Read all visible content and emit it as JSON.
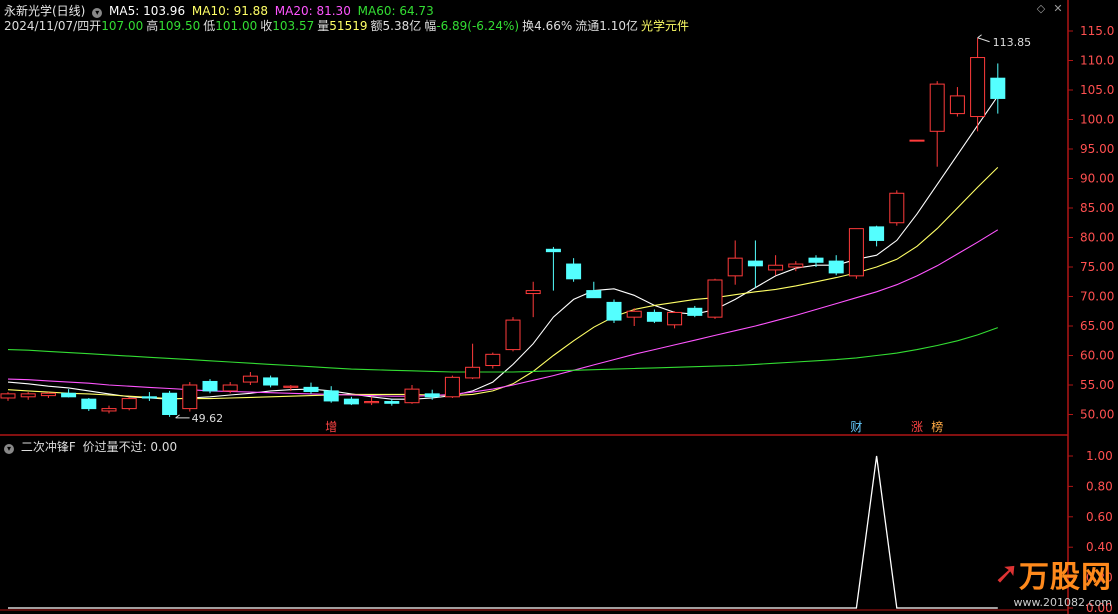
{
  "header": {
    "stock_name": "永新光学(日线)",
    "ma": [
      {
        "label": "MA5: 103.96",
        "color": "#ffffff"
      },
      {
        "label": "MA10: 91.88",
        "color": "#ffff66"
      },
      {
        "label": "MA20: 81.30",
        "color": "#ff55ff"
      },
      {
        "label": "MA60: 64.73",
        "color": "#33dd33"
      }
    ],
    "date": "2024/11/07/四",
    "open_label": "开",
    "open_value": "107.00",
    "high_label": "高",
    "high_value": "109.50",
    "low_label": "低",
    "low_value": "101.00",
    "close_label": "收",
    "close_value": "103.57",
    "vol_label": "量",
    "vol_value": "51519",
    "amt_label": "额",
    "amt_value": "5.38亿",
    "chg_label": "幅",
    "chg_value": "-6.89(-6.24%)",
    "turn_label": "换",
    "turn_value": "4.66%",
    "float_label": "流通",
    "float_value": "1.10亿",
    "sector": "光学元件"
  },
  "indicator_header": {
    "name": "二次冲锋F",
    "param": "价过量不过: 0.00"
  },
  "colors": {
    "up": "#ff3b3b",
    "down": "#54ffff",
    "ma5": "#ffffff",
    "ma10": "#ffff66",
    "ma20": "#ff55ff",
    "ma60": "#33dd33",
    "axis": "#b01515",
    "tick": "#ff5050"
  },
  "chart_data": [
    {
      "type": "candlestick",
      "ylim": [
        47.5,
        116.5
      ],
      "yticks": [
        "50.00",
        "55.00",
        "60.00",
        "65.00",
        "70.00",
        "75.00",
        "80.00",
        "85.00",
        "90.00",
        "95.00",
        "100.0",
        "105.0",
        "110.0",
        "115.0"
      ],
      "candles": [
        {
          "o": 52.8,
          "h": 53.8,
          "l": 52.3,
          "c": 53.5
        },
        {
          "o": 53.0,
          "h": 53.8,
          "l": 52.5,
          "c": 53.5
        },
        {
          "o": 53.2,
          "h": 53.8,
          "l": 52.8,
          "c": 53.6
        },
        {
          "o": 53.6,
          "h": 54.3,
          "l": 52.9,
          "c": 53.0
        },
        {
          "o": 52.6,
          "h": 52.8,
          "l": 50.6,
          "c": 51.0
        },
        {
          "o": 50.6,
          "h": 51.5,
          "l": 50.2,
          "c": 51.0
        },
        {
          "o": 51.0,
          "h": 53.0,
          "l": 50.7,
          "c": 52.7
        },
        {
          "o": 53.0,
          "h": 53.8,
          "l": 52.3,
          "c": 52.8
        },
        {
          "o": 53.6,
          "h": 54.0,
          "l": 49.6,
          "c": 50.0
        },
        {
          "o": 51.0,
          "h": 55.5,
          "l": 50.5,
          "c": 55.0
        },
        {
          "o": 55.6,
          "h": 56.0,
          "l": 53.6,
          "c": 54.0
        },
        {
          "o": 54.0,
          "h": 55.5,
          "l": 53.6,
          "c": 55.0
        },
        {
          "o": 55.5,
          "h": 57.2,
          "l": 55.0,
          "c": 56.5
        },
        {
          "o": 56.2,
          "h": 56.6,
          "l": 54.6,
          "c": 55.0
        },
        {
          "o": 54.6,
          "h": 55.0,
          "l": 54.0,
          "c": 54.8
        },
        {
          "o": 54.6,
          "h": 55.4,
          "l": 53.5,
          "c": 53.9
        },
        {
          "o": 54.0,
          "h": 54.8,
          "l": 52.0,
          "c": 52.3
        },
        {
          "o": 52.6,
          "h": 53.0,
          "l": 51.6,
          "c": 51.8
        },
        {
          "o": 52.0,
          "h": 53.0,
          "l": 51.6,
          "c": 52.2
        },
        {
          "o": 52.2,
          "h": 52.6,
          "l": 51.5,
          "c": 51.9
        },
        {
          "o": 52.0,
          "h": 55.0,
          "l": 51.8,
          "c": 54.3
        },
        {
          "o": 53.5,
          "h": 54.2,
          "l": 52.5,
          "c": 53.0
        },
        {
          "o": 53.0,
          "h": 56.6,
          "l": 52.8,
          "c": 56.3
        },
        {
          "o": 56.2,
          "h": 62.0,
          "l": 56.0,
          "c": 58.0
        },
        {
          "o": 58.3,
          "h": 60.5,
          "l": 57.8,
          "c": 60.2
        },
        {
          "o": 61.0,
          "h": 66.5,
          "l": 60.7,
          "c": 66.0
        },
        {
          "o": 70.5,
          "h": 72.5,
          "l": 66.5,
          "c": 71.0
        },
        {
          "o": 78.0,
          "h": 78.4,
          "l": 71.0,
          "c": 77.6
        },
        {
          "o": 75.5,
          "h": 76.5,
          "l": 72.5,
          "c": 73.0
        },
        {
          "o": 71.0,
          "h": 72.5,
          "l": 69.8,
          "c": 69.8
        },
        {
          "o": 69.0,
          "h": 69.5,
          "l": 65.5,
          "c": 66.0
        },
        {
          "o": 66.5,
          "h": 68.0,
          "l": 65.0,
          "c": 67.5
        },
        {
          "o": 67.3,
          "h": 67.8,
          "l": 65.5,
          "c": 65.8
        },
        {
          "o": 65.2,
          "h": 67.5,
          "l": 64.6,
          "c": 67.3
        },
        {
          "o": 68.0,
          "h": 68.4,
          "l": 66.5,
          "c": 66.8
        },
        {
          "o": 66.5,
          "h": 73.0,
          "l": 66.2,
          "c": 72.8
        },
        {
          "o": 73.5,
          "h": 79.5,
          "l": 72.0,
          "c": 76.5
        },
        {
          "o": 76.0,
          "h": 79.5,
          "l": 71.5,
          "c": 75.2
        },
        {
          "o": 74.5,
          "h": 77.0,
          "l": 73.6,
          "c": 75.3
        },
        {
          "o": 75.0,
          "h": 76.0,
          "l": 74.3,
          "c": 75.5
        },
        {
          "o": 76.5,
          "h": 77.0,
          "l": 75.0,
          "c": 75.8
        },
        {
          "o": 76.0,
          "h": 77.0,
          "l": 73.6,
          "c": 74.0
        },
        {
          "o": 73.5,
          "h": 81.5,
          "l": 73.0,
          "c": 81.5
        },
        {
          "o": 81.8,
          "h": 82.0,
          "l": 78.5,
          "c": 79.5
        },
        {
          "o": 82.5,
          "h": 88.0,
          "l": 82.0,
          "c": 87.5
        },
        {
          "o": 96.5,
          "h": 96.5,
          "l": 96.3,
          "c": 96.5
        },
        {
          "o": 98.0,
          "h": 106.5,
          "l": 92.0,
          "c": 106.0
        },
        {
          "o": 101.0,
          "h": 105.5,
          "l": 100.5,
          "c": 104.0
        },
        {
          "o": 100.5,
          "h": 113.85,
          "l": 98.0,
          "c": 110.5
        },
        {
          "o": 107.0,
          "h": 109.5,
          "l": 101.0,
          "c": 103.57
        }
      ],
      "ma_series": [
        {
          "name": "MA5",
          "values": [
            55.5,
            55.2,
            54.8,
            54.5,
            54.0,
            53.5,
            53.0,
            52.8,
            52.6,
            52.8,
            53.0,
            53.3,
            53.6,
            54.0,
            54.2,
            54.3,
            54.0,
            53.5,
            53.0,
            52.6,
            52.6,
            52.8,
            53.2,
            54.0,
            55.5,
            58.5,
            62.0,
            66.5,
            69.5,
            71.0,
            71.3,
            70.2,
            68.5,
            67.3,
            67.0,
            67.8,
            69.5,
            71.5,
            73.5,
            74.8,
            75.3,
            75.3,
            76.3,
            77.0,
            79.5,
            84.0,
            89.0,
            94.0,
            99.0,
            103.96
          ]
        },
        {
          "name": "MA10",
          "values": [
            54.2,
            54.0,
            53.8,
            53.6,
            53.5,
            53.3,
            53.1,
            52.9,
            52.7,
            52.7,
            52.7,
            52.8,
            52.9,
            53.0,
            53.1,
            53.2,
            53.3,
            53.4,
            53.4,
            53.4,
            53.4,
            53.3,
            53.2,
            53.4,
            54.0,
            55.2,
            57.3,
            60.0,
            62.5,
            64.8,
            66.6,
            67.8,
            68.5,
            69.0,
            69.5,
            69.8,
            70.3,
            70.8,
            71.2,
            71.8,
            72.5,
            73.2,
            74.0,
            75.0,
            76.3,
            78.5,
            81.5,
            85.0,
            88.5,
            91.88
          ]
        },
        {
          "name": "MA20",
          "values": [
            56.0,
            55.9,
            55.7,
            55.5,
            55.3,
            55.0,
            54.8,
            54.6,
            54.4,
            54.2,
            54.0,
            53.9,
            53.8,
            53.7,
            53.6,
            53.5,
            53.4,
            53.3,
            53.2,
            53.1,
            53.1,
            53.2,
            53.4,
            53.8,
            54.3,
            55.0,
            55.8,
            56.6,
            57.5,
            58.4,
            59.3,
            60.2,
            61.0,
            61.8,
            62.6,
            63.4,
            64.2,
            65.0,
            65.9,
            66.8,
            67.8,
            68.8,
            69.8,
            70.8,
            72.0,
            73.5,
            75.2,
            77.2,
            79.2,
            81.3
          ]
        },
        {
          "name": "MA60",
          "values": [
            61.0,
            60.9,
            60.7,
            60.5,
            60.3,
            60.1,
            59.9,
            59.7,
            59.5,
            59.3,
            59.1,
            58.9,
            58.7,
            58.5,
            58.3,
            58.1,
            57.9,
            57.7,
            57.6,
            57.5,
            57.4,
            57.3,
            57.2,
            57.2,
            57.2,
            57.2,
            57.3,
            57.4,
            57.5,
            57.6,
            57.7,
            57.8,
            57.9,
            58.0,
            58.1,
            58.2,
            58.3,
            58.5,
            58.7,
            58.9,
            59.1,
            59.3,
            59.6,
            60.0,
            60.4,
            61.0,
            61.7,
            62.5,
            63.5,
            64.73
          ]
        }
      ],
      "annotations": [
        {
          "text": "113.85",
          "type": "high-marker"
        },
        {
          "text": "49.62",
          "type": "low-marker"
        }
      ],
      "event_labels": [
        {
          "text": "增",
          "index": 16,
          "color": "#ff4444"
        },
        {
          "text": "财",
          "index": 42,
          "color": "#66ccff"
        },
        {
          "text": "涨",
          "index": 45,
          "color": "#ff4444"
        },
        {
          "text": "榜",
          "index": 46,
          "color": "#ffaa44"
        }
      ]
    },
    {
      "type": "line",
      "name": "二次冲锋F",
      "ylim": [
        0,
        1.05
      ],
      "yticks": [
        "0.00",
        "0.20",
        "0.40",
        "0.60",
        "0.80",
        "1.00"
      ],
      "values": [
        0,
        0,
        0,
        0,
        0,
        0,
        0,
        0,
        0,
        0,
        0,
        0,
        0,
        0,
        0,
        0,
        0,
        0,
        0,
        0,
        0,
        0,
        0,
        0,
        0,
        0,
        0,
        0,
        0,
        0,
        0,
        0,
        0,
        0,
        0,
        0,
        0,
        0,
        0,
        0,
        0,
        0,
        0,
        1,
        0,
        0,
        0,
        0,
        0,
        0
      ]
    }
  ],
  "watermark": {
    "text": "万股网",
    "url": "www.201082.com"
  }
}
